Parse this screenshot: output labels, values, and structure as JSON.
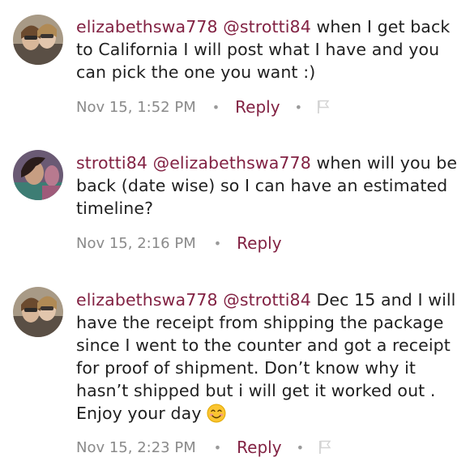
{
  "comments": [
    {
      "username": "elizabethswa778",
      "mention": "@strotti84",
      "text": " when I get back to California I will post what I have and you can pick the one you want :)",
      "timestamp": "Nov 15, 1:52 PM",
      "reply_label": "Reply",
      "separator": "•",
      "has_flag": true,
      "has_emoji": false
    },
    {
      "username": "strotti84",
      "mention": "@elizabethswa778",
      "text": " when will you be back (date wise) so I can have an estimated timeline?",
      "timestamp": "Nov 15, 2:16 PM",
      "reply_label": "Reply",
      "separator": "•",
      "has_flag": false,
      "has_emoji": false
    },
    {
      "username": "elizabethswa778",
      "mention": "@strotti84",
      "text": " Dec 15 and I will have the receipt from shipping the package since I went to the counter and got a receipt for proof of shipment. Don’t know why it hasn’t shipped but i will get it worked out . Enjoy your day ",
      "timestamp": "Nov 15, 2:23 PM",
      "reply_label": "Reply",
      "separator": "•",
      "has_flag": true,
      "has_emoji": true,
      "emoji_icon": "smiling-face-emoji-icon"
    }
  ],
  "colors": {
    "accent": "#822243",
    "meta_text": "#8a8a8a",
    "body_text": "#1f1f1f",
    "flag": "#d4d4d4",
    "background": "#ffffff"
  }
}
